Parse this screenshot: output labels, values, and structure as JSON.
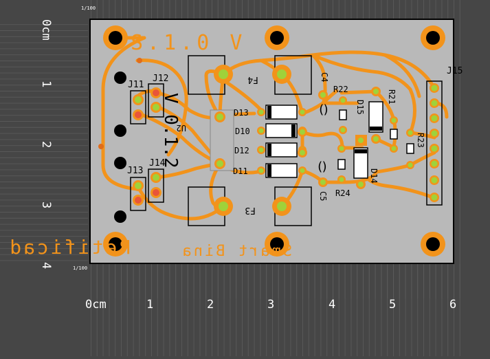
{
  "colors": {
    "background": "#464646",
    "ruler_lines": "#6e6e6e",
    "board": "#b9b9b9",
    "board_outline": "#000000",
    "copper": "#f2931b",
    "pad": "#9fd23a",
    "pad_red": "#e8553a",
    "silk": "#000000",
    "ruler_text": "#ffffff"
  },
  "ruler": {
    "units_x": "0cm",
    "units_y": "0cm",
    "x_ticks": [
      "1",
      "2",
      "3",
      "4",
      "5",
      "6"
    ],
    "y_ticks": [
      "1",
      "2",
      "3",
      "4"
    ],
    "scale_label_top": "1/100",
    "scale_label_bottom": "1/100"
  },
  "board": {
    "copper_text_top": "S.1.0 V",
    "copper_text_bottom_left": "Retificad",
    "copper_text_bottom_right": "Smart Bina",
    "copper_text_side_right": "V 0.1.2",
    "components": {
      "j11": "J11",
      "j12": "J12",
      "j13": "J13",
      "j14": "J14",
      "j15": "J15",
      "u2": "U2",
      "f4": "F4",
      "f3": "F3",
      "c4": "C4",
      "c5": "C5",
      "d10": "D10",
      "d11": "D11",
      "d12": "D12",
      "d13": "D13",
      "d14": "D14",
      "d15": "D15",
      "r21": "R21",
      "r22": "R22",
      "r23": "R23",
      "r24": "R24"
    }
  }
}
